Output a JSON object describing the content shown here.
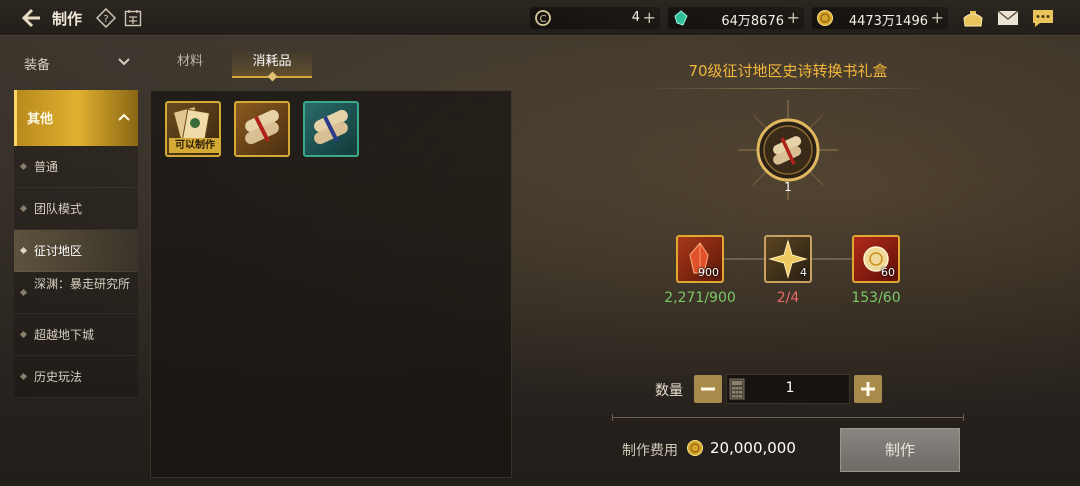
{
  "header": {
    "title": "制作",
    "currencies": [
      {
        "icon": "coin-c-icon",
        "value": "4"
      },
      {
        "icon": "green-gem-icon",
        "value": "64万8676"
      },
      {
        "icon": "gold-coin-icon",
        "value": "4473万1496"
      }
    ]
  },
  "sidebar": {
    "categories": [
      {
        "label": "装备",
        "expanded": false
      },
      {
        "label": "其他",
        "expanded": true
      }
    ],
    "items": [
      {
        "label": "普通"
      },
      {
        "label": "团队模式"
      },
      {
        "label": "征讨地区",
        "selected": true
      },
      {
        "label": "深渊：暴走研究所"
      },
      {
        "label": "超越地下城"
      },
      {
        "label": "历史玩法"
      }
    ]
  },
  "tabs": [
    {
      "label": "材料"
    },
    {
      "label": "消耗品",
      "active": true
    }
  ],
  "item_grid": {
    "slots": [
      {
        "icon": "cards-chest-icon",
        "badge": "可以制作"
      },
      {
        "icon": "scroll-bundle-icon"
      },
      {
        "icon": "scroll-bundle-blue-icon"
      }
    ]
  },
  "recipe": {
    "title": "70级征讨地区史诗转换书礼盒",
    "result_quantity": "1",
    "materials": [
      {
        "icon": "red-crystal-icon",
        "count": "900",
        "progress": "2,271/900",
        "status": "ok"
      },
      {
        "icon": "gold-star-shard-icon",
        "count": "4",
        "progress": "2/4",
        "status": "insufficient"
      },
      {
        "icon": "red-orb-icon",
        "count": "60",
        "progress": "153/60",
        "status": "ok"
      }
    ]
  },
  "quantity": {
    "label": "数量",
    "value": "1"
  },
  "fee": {
    "label": "制作费用",
    "value": "20,000,000"
  },
  "craft_button": "制作",
  "colors": {
    "accent_gold": "#f2b73a",
    "ok_green": "#7bc86a",
    "bad_red": "#e86a6a"
  }
}
